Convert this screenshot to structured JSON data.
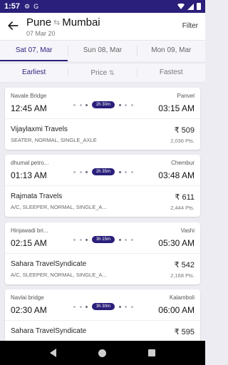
{
  "status": {
    "time": "1:57"
  },
  "header": {
    "from_city": "Pune",
    "to_city": "Mumbai",
    "date": "07 Mar 20",
    "filter_label": "Filter"
  },
  "date_tabs": [
    {
      "label": "Sat 07, Mar",
      "active": true
    },
    {
      "label": "Sun 08, Mar",
      "active": false
    },
    {
      "label": "Mon 09, Mar",
      "active": false
    }
  ],
  "sort_tabs": [
    {
      "label": "Earliest",
      "active": true
    },
    {
      "label": "Price",
      "active": false
    },
    {
      "label": "Fastest",
      "active": false
    }
  ],
  "buses": [
    {
      "from": "Navale Bridge",
      "to": "Panvel",
      "depart": "12:45 AM",
      "arrive": "03:15 AM",
      "duration": "2h 30m",
      "operator": "Vijaylaxmi Travels",
      "tags": "SEATER,  NORMAL,  SINGLE_AXLE",
      "price": "₹ 509",
      "points": "2,036 Pts."
    },
    {
      "from": "dhumal petro...",
      "to": "Chembur",
      "depart": "01:13 AM",
      "arrive": "03:48 AM",
      "duration": "2h 35m",
      "operator": "Rajmata Travels",
      "tags": "A/C, SLEEPER,  NORMAL,  SINGLE_A...",
      "price": "₹ 611",
      "points": "2,444 Pts."
    },
    {
      "from": "Hinjawadi bri...",
      "to": "Vashi",
      "depart": "02:15 AM",
      "arrive": "05:30 AM",
      "duration": "3h 15m",
      "operator": "Sahara TravelSyndicate",
      "tags": "A/C, SLEEPER,  NORMAL,  SINGLE_A...",
      "price": "₹ 542",
      "points": "2,168 Pts."
    },
    {
      "from": "Navlai bridge",
      "to": "Kalamboli",
      "depart": "02:30 AM",
      "arrive": "06:00 AM",
      "duration": "3h 30m",
      "operator": "Sahara TravelSyndicate",
      "tags": "",
      "price": "₹ 595",
      "points": ""
    }
  ]
}
